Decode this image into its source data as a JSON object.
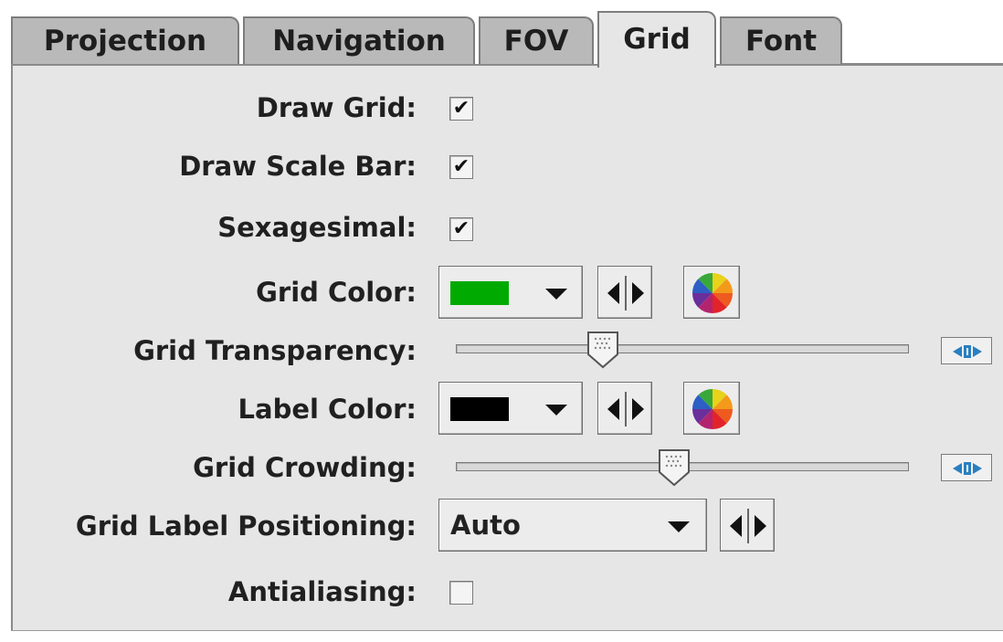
{
  "tabs": [
    {
      "label": "Projection",
      "selected": false
    },
    {
      "label": "Navigation",
      "selected": false
    },
    {
      "label": "FOV",
      "selected": false
    },
    {
      "label": "Grid",
      "selected": true
    },
    {
      "label": "Font",
      "selected": false
    }
  ],
  "form": {
    "draw_grid": {
      "label": "Draw Grid:",
      "checked": true,
      "mark": "✔"
    },
    "draw_scale_bar": {
      "label": "Draw Scale Bar:",
      "checked": true,
      "mark": "✔"
    },
    "sexagesimal": {
      "label": "Sexagesimal:",
      "checked": true,
      "mark": "✔"
    },
    "grid_color": {
      "label": "Grid Color:",
      "color": "#00aa00",
      "icon": "color-wheel-icon"
    },
    "grid_transparency": {
      "label": "Grid Transparency:",
      "value_fraction": 0.31,
      "reset_icon": "reset-slider-icon"
    },
    "label_color": {
      "label": "Label Color:",
      "color": "#000000",
      "icon": "color-wheel-icon"
    },
    "grid_crowding": {
      "label": "Grid Crowding:",
      "value_fraction": 0.48,
      "reset_icon": "reset-slider-icon"
    },
    "grid_label_positioning": {
      "label": "Grid Label Positioning:",
      "value": "Auto"
    },
    "antialiasing": {
      "label": "Antialiasing:",
      "checked": false,
      "mark": ""
    }
  }
}
